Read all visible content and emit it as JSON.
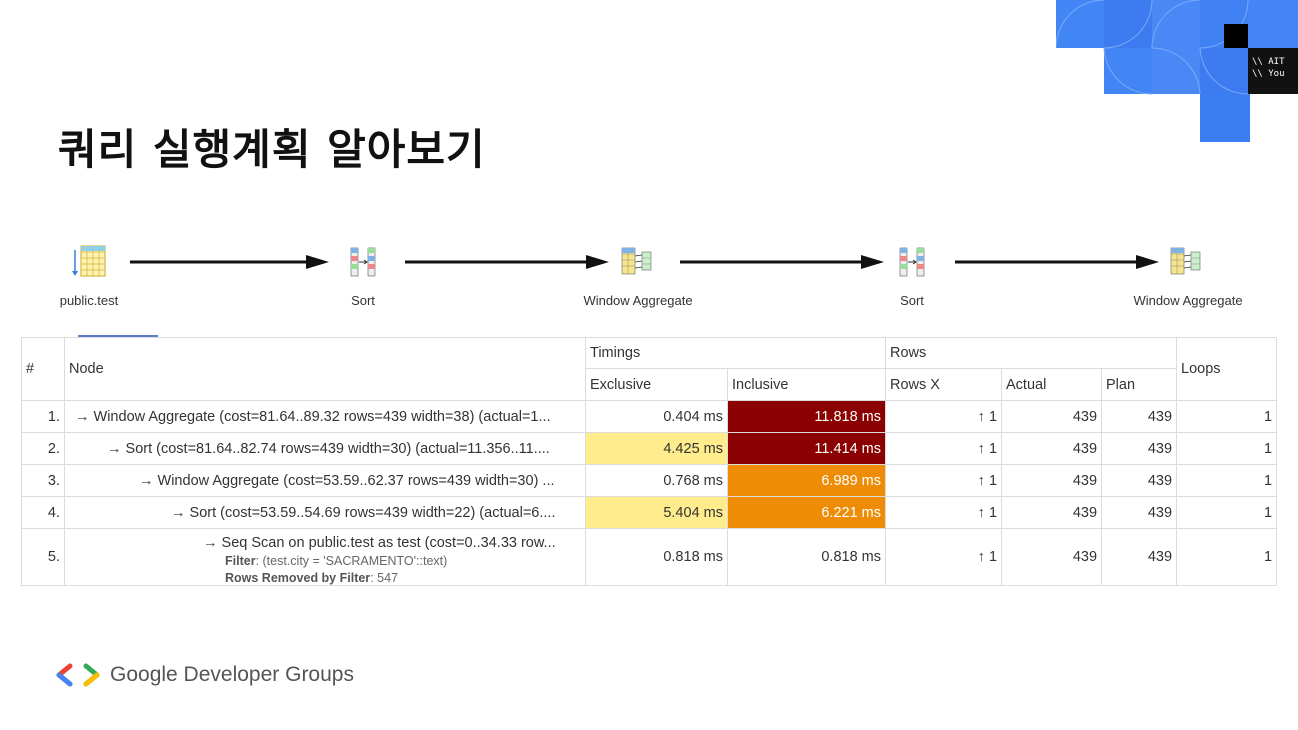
{
  "slide": {
    "title": "쿼리 실행계획 알아보기",
    "footer_brand": "Google Developer Groups",
    "colors": {
      "accent_blue": "#4285f4",
      "dark_red": "#8b0000",
      "orange": "#ef8c06",
      "yellow": "#ffec8c"
    }
  },
  "flow": {
    "nodes": [
      {
        "label": "public.test",
        "icon": "table-scan-icon"
      },
      {
        "label": "Sort",
        "icon": "sort-icon"
      },
      {
        "label": "Window Aggregate",
        "icon": "window-aggregate-icon"
      },
      {
        "label": "Sort",
        "icon": "sort-icon"
      },
      {
        "label": "Window Aggregate",
        "icon": "window-aggregate-icon"
      }
    ]
  },
  "table": {
    "headers": {
      "index": "#",
      "node": "Node",
      "timings": "Timings",
      "exclusive": "Exclusive",
      "inclusive": "Inclusive",
      "rows": "Rows",
      "rows_x": "Rows X",
      "actual": "Actual",
      "plan": "Plan",
      "loops": "Loops"
    },
    "rows": [
      {
        "index": "1.",
        "node": "→ Window Aggregate (cost=81.64..89.32 rows=439 width=38) (actual=1...",
        "exclusive": "0.404 ms",
        "inclusive": "11.818 ms",
        "rows_x": "↑ 1",
        "actual": "439",
        "plan": "439",
        "loops": "1"
      },
      {
        "index": "2.",
        "node": "→ Sort (cost=81.64..82.74 rows=439 width=30) (actual=11.356..11....",
        "exclusive": "4.425 ms",
        "inclusive": "11.414 ms",
        "rows_x": "↑ 1",
        "actual": "439",
        "plan": "439",
        "loops": "1"
      },
      {
        "index": "3.",
        "node": "→ Window Aggregate (cost=53.59..62.37 rows=439 width=30) ...",
        "exclusive": "0.768 ms",
        "inclusive": "6.989 ms",
        "rows_x": "↑ 1",
        "actual": "439",
        "plan": "439",
        "loops": "1"
      },
      {
        "index": "4.",
        "node": "→ Sort (cost=53.59..54.69 rows=439 width=22) (actual=6....",
        "exclusive": "5.404 ms",
        "inclusive": "6.221 ms",
        "rows_x": "↑ 1",
        "actual": "439",
        "plan": "439",
        "loops": "1"
      },
      {
        "index": "5.",
        "node": "→ Seq Scan on public.test as test (cost=0..34.33 row...",
        "filter_label": "Filter",
        "filter_value": ": (test.city = 'SACRAMENTO'::text)",
        "removed_label": "Rows Removed by Filter",
        "removed_value": ": 547",
        "exclusive": "0.818 ms",
        "inclusive": "0.818 ms",
        "rows_x": "↑ 1",
        "actual": "439",
        "plan": "439",
        "loops": "1"
      }
    ]
  },
  "decoration": {
    "code_lines": [
      "\\\\ AIT",
      "\\\\ You"
    ]
  }
}
